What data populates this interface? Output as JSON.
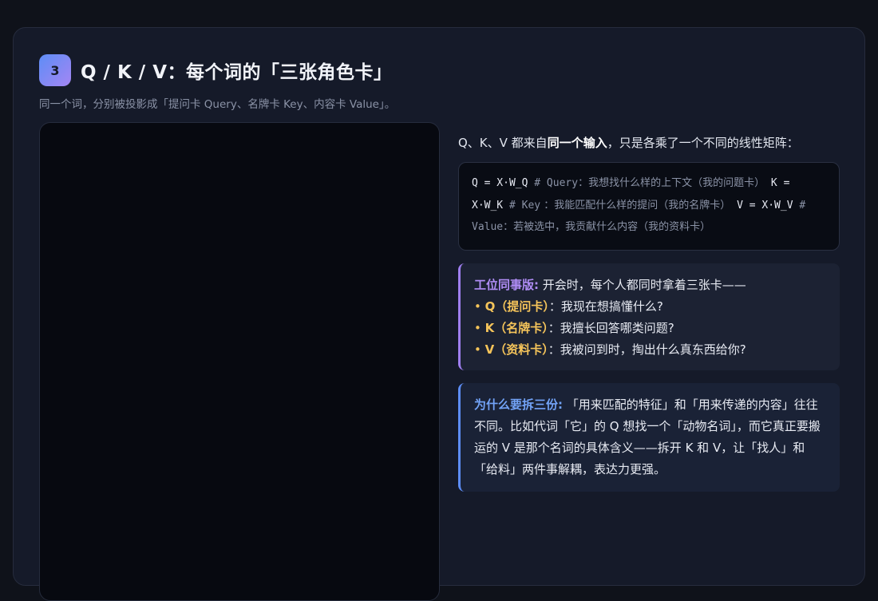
{
  "header": {
    "step_number": "3",
    "title": "Q / K / V：每个词的「三张角色卡」",
    "subtitle": "同一个词，分别被投影成「提问卡 Query、名牌卡 Key、内容卡 Value」。"
  },
  "intro": {
    "prefix": "Q、K、V 都来自",
    "bold": "同一个输入",
    "suffix": "，只是各乘了一个不同的线性矩阵："
  },
  "code": [
    {
      "expr": "Q = X·W_Q",
      "comment_key": "# Query",
      "comment": "：我想找什么样的上下文（我的问题卡）"
    },
    {
      "expr": "K = X·W_K",
      "comment_key": "# Key",
      "comment": " ：我能匹配什么样的提问（我的名牌卡）"
    },
    {
      "expr": "V = X·W_V",
      "comment_key": "# Value",
      "comment": "：若被选中，我贡献什么内容（我的资料卡）"
    }
  ],
  "analogy": {
    "lead": "工位同事版:",
    "intro": " 开会时，每个人都同时拿着三张卡——",
    "items": [
      {
        "bullet": "• ",
        "name": "Q（提问卡）",
        "desc": "：我现在想搞懂什么?"
      },
      {
        "bullet": "• ",
        "name": "K（名牌卡）",
        "desc": "：我擅长回答哪类问题?"
      },
      {
        "bullet": "• ",
        "name": "V（资料卡）",
        "desc": "：我被问到时，掏出什么真东西给你?"
      }
    ]
  },
  "why": {
    "lead": "为什么要拆三份:",
    "text": " 「用来匹配的特征」和「用来传递的内容」往往不同。比如代词「它」的 Q 想找一个「动物名词」，而它真正要搬运的 V 是那个名词的具体含义——拆开 K 和 V，让「找人」和「给料」两件事解耦，表达力更强。"
  },
  "colors": {
    "badge_gradient_start": "#5d8df6",
    "badge_gradient_end": "#a486f3",
    "analogy_accent": "#9f7ff0",
    "card_name_color": "#f5c45a",
    "why_accent": "#5d8df6"
  }
}
